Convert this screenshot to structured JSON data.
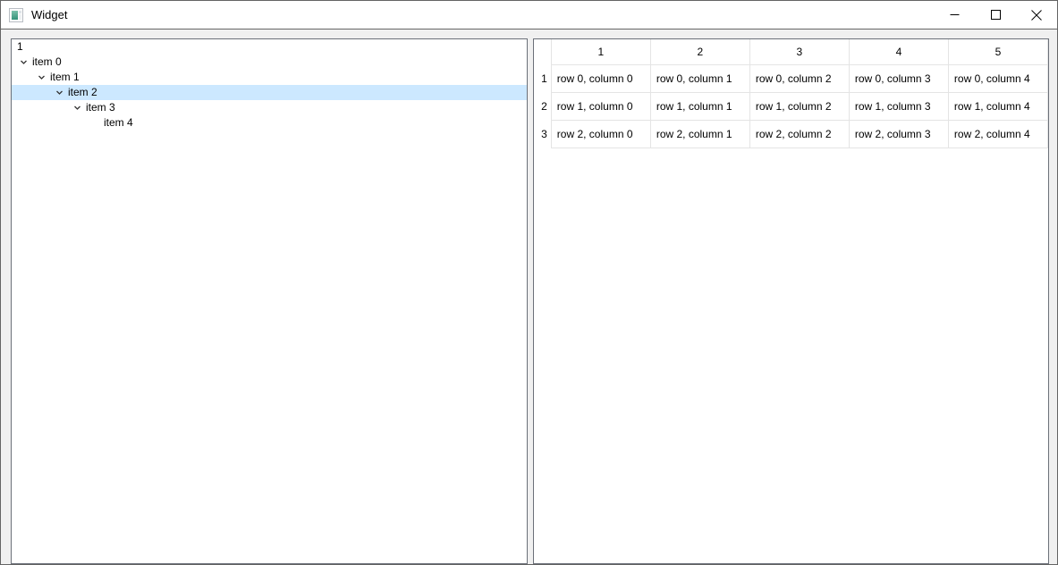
{
  "window": {
    "title": "Widget",
    "icon": "widget-app-icon",
    "controls": [
      {
        "name": "minimize-button",
        "glyph": "minimize-icon"
      },
      {
        "name": "maximize-button",
        "glyph": "maximize-icon"
      },
      {
        "name": "close-button",
        "glyph": "close-icon"
      }
    ]
  },
  "tree": {
    "header": "1",
    "rows": [
      {
        "label": "item 0",
        "depth": 0,
        "expander": "chevron-down-icon",
        "selected": false
      },
      {
        "label": "item 1",
        "depth": 1,
        "expander": "chevron-down-icon",
        "selected": false
      },
      {
        "label": "item 2",
        "depth": 2,
        "expander": "chevron-down-icon",
        "selected": true
      },
      {
        "label": "item 3",
        "depth": 3,
        "expander": "chevron-down-icon",
        "selected": false
      },
      {
        "label": "item 4",
        "depth": 4,
        "expander": "none",
        "selected": false
      }
    ]
  },
  "table": {
    "corner": "",
    "column_headers": [
      "1",
      "2",
      "3",
      "4",
      "5"
    ],
    "row_headers": [
      "1",
      "2",
      "3"
    ],
    "rows": [
      [
        "row 0, column 0",
        "row 0, column 1",
        "row 0, column 2",
        "row 0, column 3",
        "row 0, column 4"
      ],
      [
        "row 1, column 0",
        "row 1, column 1",
        "row 1, column 2",
        "row 1, column 3",
        "row 1, column 4"
      ],
      [
        "row 2, column 0",
        "row 2, column 1",
        "row 2, column 2",
        "row 2, column 3",
        "row 2, column 4"
      ]
    ]
  },
  "colors": {
    "selection": "#cce8ff",
    "panel_border": "#6b7079",
    "grid_line": "#e4e4e4",
    "window_bg": "#f0f0f0",
    "titlebar_bg": "#ffffff"
  }
}
